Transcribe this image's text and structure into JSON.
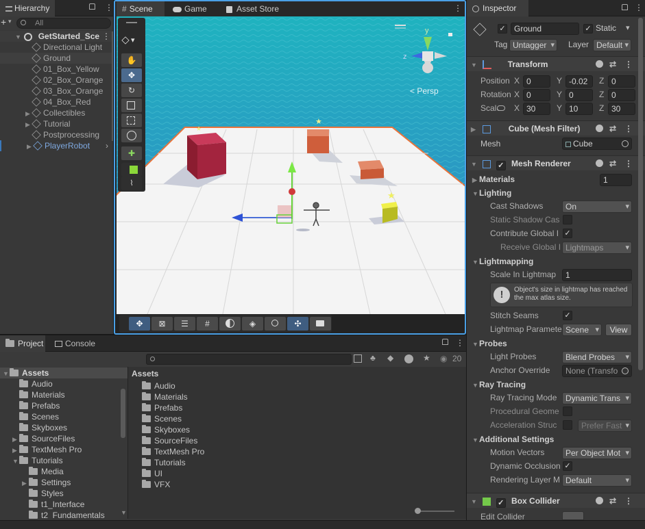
{
  "hierarchy": {
    "tab_label": "Hierarchy",
    "search_placeholder": "All",
    "scene_name": "GetStarted_Sce",
    "items": [
      {
        "label": "Directional Light"
      },
      {
        "label": "Ground"
      },
      {
        "label": "01_Box_Yellow"
      },
      {
        "label": "02_Box_Orange"
      },
      {
        "label": "03_Box_Orange"
      },
      {
        "label": "04_Box_Red"
      },
      {
        "label": "Collectibles"
      },
      {
        "label": "Tutorial"
      },
      {
        "label": "Postprocessing"
      },
      {
        "label": "PlayerRobot"
      }
    ]
  },
  "scene_tabs": {
    "scene": "Scene",
    "game": "Game",
    "asset_store": "Asset Store"
  },
  "scene_view": {
    "persp_label": "Persp",
    "gizmo_y": "y",
    "gizmo_z": "z"
  },
  "project": {
    "tab_project": "Project",
    "tab_console": "Console",
    "visible_count": "20",
    "tree": [
      {
        "label": "Assets"
      },
      {
        "label": "Audio"
      },
      {
        "label": "Materials"
      },
      {
        "label": "Prefabs"
      },
      {
        "label": "Scenes"
      },
      {
        "label": "Skyboxes"
      },
      {
        "label": "SourceFiles"
      },
      {
        "label": "TextMesh Pro"
      },
      {
        "label": "Tutorials"
      },
      {
        "label": "Media"
      },
      {
        "label": "Settings"
      },
      {
        "label": "Styles"
      },
      {
        "label": "t1_Interface"
      },
      {
        "label": "t2_Fundamentals"
      }
    ],
    "breadcrumb": "Assets",
    "grid_folders": [
      {
        "label": "Audio"
      },
      {
        "label": "Materials"
      },
      {
        "label": "Prefabs"
      },
      {
        "label": "Scenes"
      },
      {
        "label": "Skyboxes"
      },
      {
        "label": "SourceFiles"
      },
      {
        "label": "TextMesh Pro"
      },
      {
        "label": "Tutorials"
      },
      {
        "label": "UI"
      },
      {
        "label": "VFX"
      }
    ]
  },
  "inspector": {
    "tab_label": "Inspector",
    "object_name": "Ground",
    "static_label": "Static",
    "tag_label": "Tag",
    "tag_value": "Untagger",
    "layer_label": "Layer",
    "layer_value": "Default",
    "transform": {
      "title": "Transform",
      "position_label": "Position",
      "rotation_label": "Rotation",
      "scale_label": "Scale",
      "position": {
        "x": "0",
        "y": "-0.02",
        "z": "0"
      },
      "rotation": {
        "x": "0",
        "y": "0",
        "z": "0"
      },
      "scale": {
        "x": "30",
        "y": "10",
        "z": "30"
      },
      "axis_x": "X",
      "axis_y": "Y",
      "axis_z": "Z"
    },
    "mesh_filter": {
      "title": "Cube (Mesh Filter)",
      "mesh_label": "Mesh",
      "mesh_value": "Cube"
    },
    "mesh_renderer": {
      "title": "Mesh Renderer",
      "materials_label": "Materials",
      "materials_count": "1",
      "lighting_label": "Lighting",
      "cast_shadows_label": "Cast Shadows",
      "cast_shadows_value": "On",
      "static_shadow_label": "Static Shadow Cas",
      "contribute_gi_label": "Contribute Global I",
      "receive_gi_label": "Receive Global I",
      "receive_gi_value": "Lightmaps",
      "lightmapping_label": "Lightmapping",
      "scale_in_lightmap_label": "Scale In Lightmap",
      "scale_in_lightmap_value": "1",
      "info_text": "Object's size in lightmap has reached the max atlas size.",
      "stitch_seams_label": "Stitch Seams",
      "lightmap_params_label": "Lightmap Paramete",
      "lightmap_params_value": "Scene",
      "view_button": "View",
      "probes_label": "Probes",
      "light_probes_label": "Light Probes",
      "light_probes_value": "Blend Probes",
      "anchor_override_label": "Anchor Override",
      "anchor_override_value": "None (Transfo",
      "ray_tracing_label": "Ray Tracing",
      "ray_tracing_mode_label": "Ray Tracing Mode",
      "ray_tracing_mode_value": "Dynamic Trans",
      "procedural_geom_label": "Procedural Geome",
      "accel_struct_label": "Acceleration Struc",
      "accel_struct_value": "Prefer Fast",
      "additional_settings_label": "Additional Settings",
      "motion_vectors_label": "Motion Vectors",
      "motion_vectors_value": "Per Object Mot",
      "dynamic_occlusion_label": "Dynamic Occlusion",
      "rendering_layer_label": "Rendering Layer M",
      "rendering_layer_value": "Default"
    },
    "box_collider": {
      "title": "Box Collider",
      "edit_collider_label": "Edit Collider"
    }
  },
  "colors": {
    "accent": "#3a79bb",
    "selected": "#2c5d87",
    "sky_top": "#2ab7c9",
    "ground": "#f3f3f3",
    "ground_edge": "#e8733a",
    "box_red": "#a3243e",
    "box_orange": "#d96c4a",
    "box_yellow": "#c6c826"
  }
}
